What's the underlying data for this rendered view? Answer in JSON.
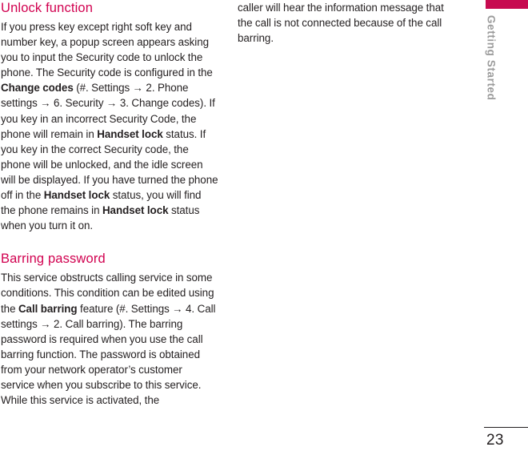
{
  "theme": {
    "accent_color": "#c70a50",
    "heading_color": "#d1004f",
    "body_color": "#231f20",
    "tab_label_color": "#9b9b9b"
  },
  "tab": {
    "label": "Getting Started"
  },
  "footer": {
    "page_number": "23"
  },
  "left_column": {
    "section1": {
      "heading": "Unlock function",
      "paragraph_parts": [
        {
          "text": "If you press key except right soft key and number key, a popup screen appears asking you to input the Security code to unlock the phone. The Security code is configured in the ",
          "bold": false
        },
        {
          "text": "Change codes",
          "bold": true
        },
        {
          "text": " (#. Settings → 2. Phone settings → 6. Security  → 3. Change codes). If you key in an incorrect Security Code, the phone will remain in ",
          "bold": false
        },
        {
          "text": "Handset lock",
          "bold": true
        },
        {
          "text": " status. If you key in the correct Security code, the phone will be unlocked, and the idle screen will be displayed. If you have turned the phone off in the ",
          "bold": false
        },
        {
          "text": "Handset lock",
          "bold": true
        },
        {
          "text": " status, you will find the phone remains in ",
          "bold": false
        },
        {
          "text": "Handset lock",
          "bold": true
        },
        {
          "text": " status when you turn it on.",
          "bold": false
        }
      ]
    },
    "section2": {
      "heading": "Barring password",
      "paragraph_parts": [
        {
          "text": "This service obstructs calling service in some conditions. This condition can be edited using the ",
          "bold": false
        },
        {
          "text": "Call barring",
          "bold": true
        },
        {
          "text": " feature (#. Settings → 4. Call settings → 2. Call barring). The barring password is required when you use the call barring function. The password is obtained from your network operator’s customer service when you subscribe to this service. While this service is activated, the",
          "bold": false
        }
      ]
    }
  },
  "right_column": {
    "continuation": {
      "paragraph_parts": [
        {
          "text": "caller will hear the information message that the call is not connected because of the call barring.",
          "bold": false
        }
      ]
    }
  }
}
